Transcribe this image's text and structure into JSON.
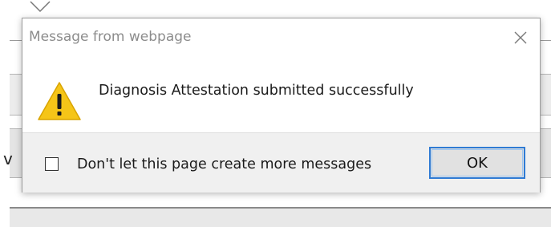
{
  "dialog": {
    "title": "Message from webpage",
    "message": "Diagnosis Attestation submitted successfully",
    "checkbox_label": "Don't let this page create more messages",
    "checkbox_checked": false,
    "ok_label": "OK",
    "icon": "warning-icon",
    "close_icon": "close-icon"
  },
  "background": {
    "partial_letter": "v"
  },
  "colors": {
    "title_text": "#8c8c8c",
    "ok_border": "#2f7bd4",
    "warning_fill": "#f5c518",
    "footer_bg": "#f0f0f0"
  }
}
